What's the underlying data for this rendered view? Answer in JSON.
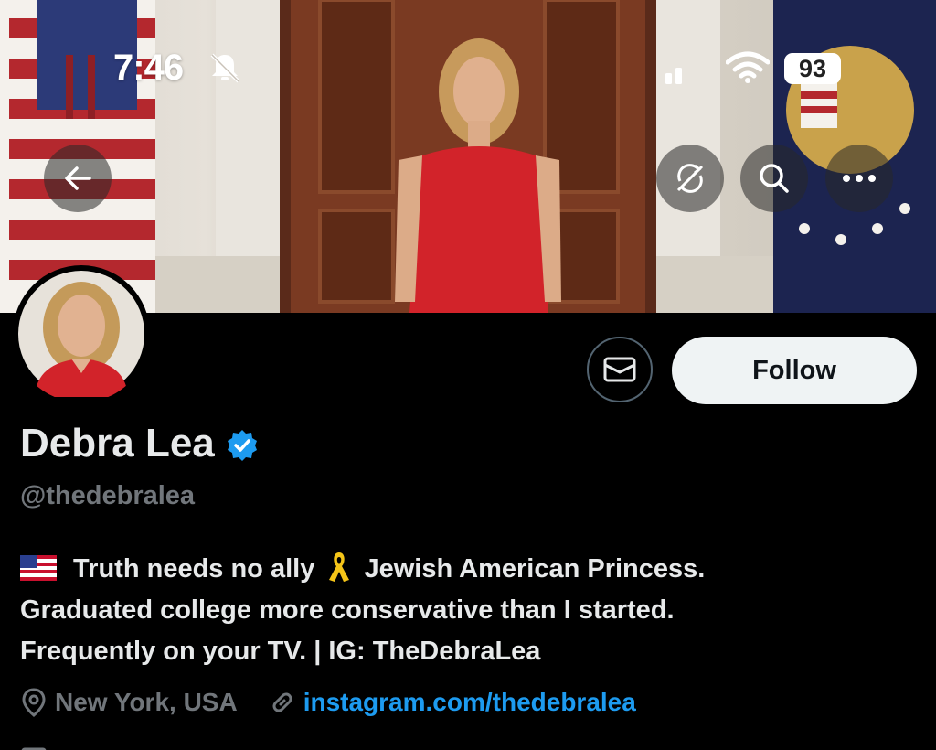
{
  "status_bar": {
    "time": "7:46",
    "battery": "93",
    "icons": [
      "bell-slash-icon",
      "signal-icon",
      "wifi-icon",
      "battery-icon"
    ]
  },
  "header": {
    "buttons": [
      "back-arrow-icon",
      "sync-off-icon",
      "search-icon",
      "more-icon"
    ]
  },
  "profile": {
    "display_name": "Debra Lea",
    "handle": "@thedebralea",
    "verified": true,
    "follow_label": "Follow",
    "message_icon": "envelope-icon",
    "bio_lines": [
      "Truth needs no ally",
      "Jewish American Princess.",
      "Graduated college more conservative than I started.",
      "Frequently on your TV. | IG: TheDebraLea"
    ],
    "location": "New York, USA",
    "website": "instagram.com/thedebralea"
  },
  "colors": {
    "background": "#000000",
    "primary_text": "#e7e9ea",
    "secondary_text": "#71767b",
    "link": "#1d9bf0",
    "verified_badge": "#1d9bf0",
    "follow_button": "#eff3f4"
  }
}
